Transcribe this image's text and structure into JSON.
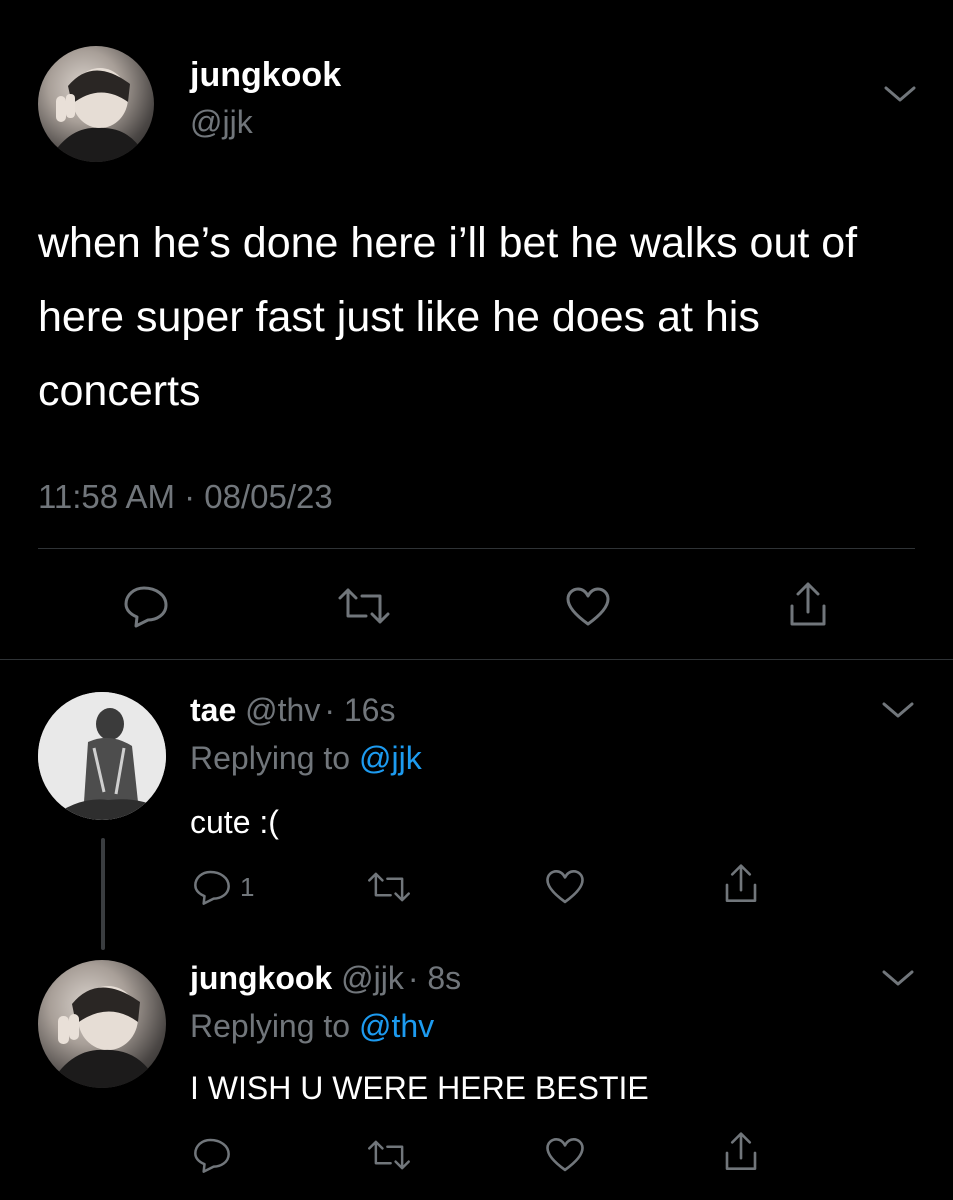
{
  "main_tweet": {
    "display_name": "jungkook",
    "handle": "@jjk",
    "text": "when he’s done here i’ll bet he walks out of here super fast just like he does at his concerts",
    "timestamp": "11:58 AM · 08/05/23",
    "actions": [
      "reply-icon",
      "retweet-icon",
      "like-icon",
      "share-icon"
    ]
  },
  "replies": [
    {
      "display_name": "tae",
      "handle": "@thv",
      "time": "· 16s",
      "replying_label": "Replying to",
      "replying_handle": "@jjk",
      "text": "cute :(",
      "reply_count": "1"
    },
    {
      "display_name": "jungkook",
      "handle": "@jjk",
      "time": "· 8s",
      "replying_label": "Replying to",
      "replying_handle": "@thv",
      "text": "I WISH U WERE HERE BESTIE",
      "reply_count": ""
    }
  ],
  "colors": {
    "background": "#000000",
    "text": "#e7e9ea",
    "secondary": "#71767b",
    "accent": "#1d9bf0",
    "divider": "#2f3336"
  }
}
